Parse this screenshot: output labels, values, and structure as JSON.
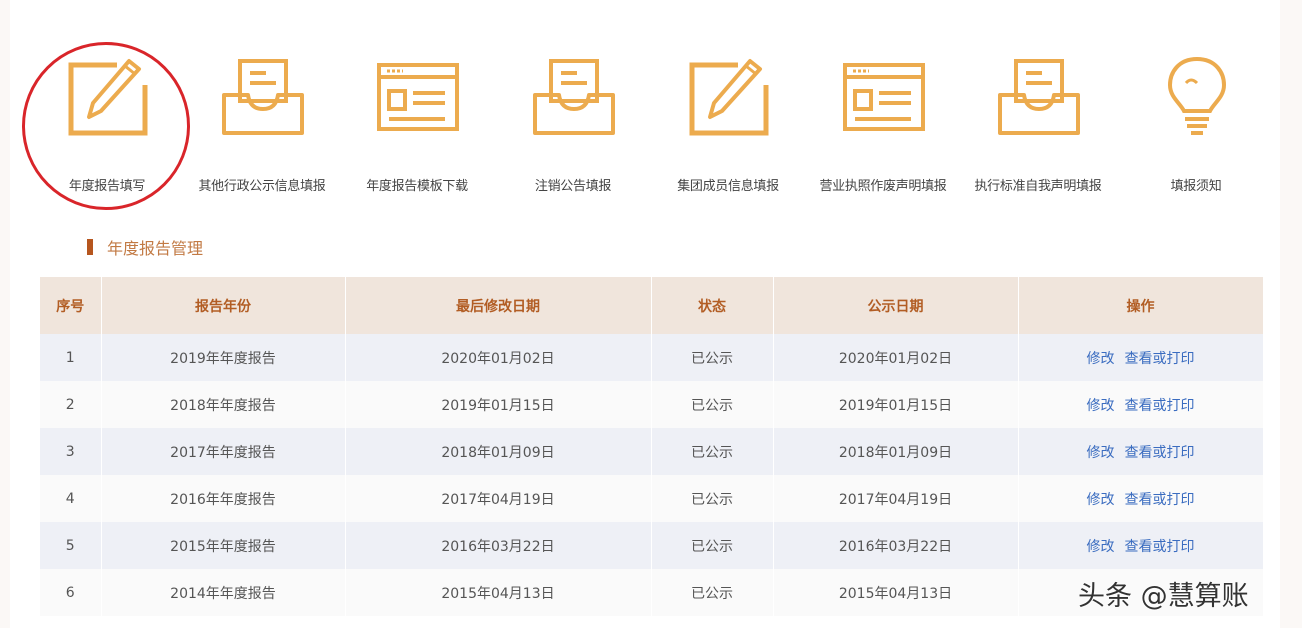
{
  "nav": {
    "items": [
      {
        "label": "年度报告填写",
        "icon": "edit-pencil-icon"
      },
      {
        "label": "其他行政公示信息填报",
        "icon": "inbox-tray-icon"
      },
      {
        "label": "年度报告模板下载",
        "icon": "form-template-icon"
      },
      {
        "label": "注销公告填报",
        "icon": "inbox-tray-icon"
      },
      {
        "label": "集团成员信息填报",
        "icon": "edit-pencil-icon"
      },
      {
        "label": "营业执照作废声明填报",
        "icon": "form-template-icon"
      },
      {
        "label": "执行标准自我声明填报",
        "icon": "inbox-tray-icon"
      },
      {
        "label": "填报须知",
        "icon": "lightbulb-icon"
      }
    ]
  },
  "section": {
    "title": "年度报告管理"
  },
  "table": {
    "headers": [
      "序号",
      "报告年份",
      "最后修改日期",
      "状态",
      "公示日期",
      "操作"
    ],
    "rows": [
      {
        "no": "1",
        "year": "2019年年度报告",
        "modified": "2020年01月02日",
        "status": "已公示",
        "published": "2020年01月02日"
      },
      {
        "no": "2",
        "year": "2018年年度报告",
        "modified": "2019年01月15日",
        "status": "已公示",
        "published": "2019年01月15日"
      },
      {
        "no": "3",
        "year": "2017年年度报告",
        "modified": "2018年01月09日",
        "status": "已公示",
        "published": "2018年01月09日"
      },
      {
        "no": "4",
        "year": "2016年年度报告",
        "modified": "2017年04月19日",
        "status": "已公示",
        "published": "2017年04月19日"
      },
      {
        "no": "5",
        "year": "2015年年度报告",
        "modified": "2016年03月22日",
        "status": "已公示",
        "published": "2016年03月22日"
      },
      {
        "no": "6",
        "year": "2014年年度报告",
        "modified": "2015年04月13日",
        "status": "已公示",
        "published": "2015年04月13日"
      }
    ],
    "actions": {
      "edit": "修改",
      "view": "查看或打印"
    }
  },
  "watermark": "头条 @慧算账",
  "colors": {
    "icon": "#ecab4e",
    "accent": "#b6561e",
    "link": "#3a6cc0",
    "highlight_circle": "#d9252a"
  }
}
